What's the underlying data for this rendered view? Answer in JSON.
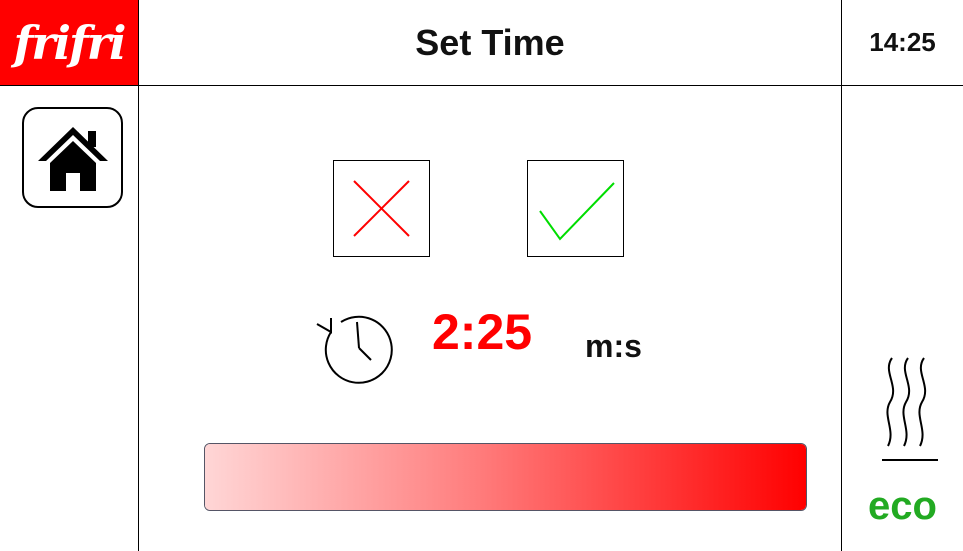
{
  "header": {
    "logo": "frifri",
    "title": "Set Time",
    "clock": "14:25"
  },
  "sidebar": {
    "home_icon": "home-icon"
  },
  "actions": {
    "cancel_icon": "x-icon",
    "confirm_icon": "check-icon"
  },
  "timer": {
    "icon": "timer-icon",
    "value": "2:25",
    "unit": "m:s"
  },
  "progress": {
    "fraction": 1.0
  },
  "right_panel": {
    "heat_icon": "heat-waves-icon",
    "mode_label": "eco"
  },
  "colors": {
    "brand": "#ff0000",
    "timer_value": "#ff0000",
    "cancel_x": "#ff0000",
    "confirm_check": "#00dd00",
    "eco": "#22aa22"
  }
}
